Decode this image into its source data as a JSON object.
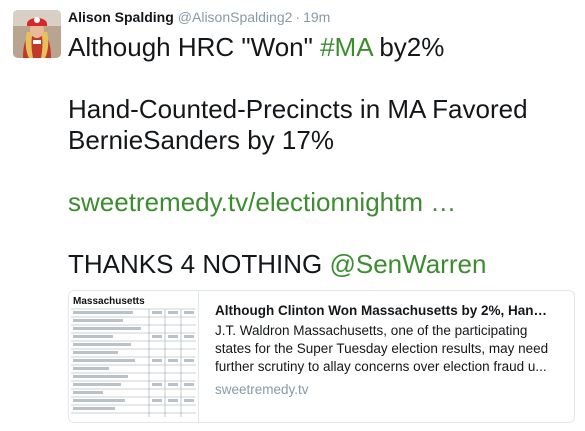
{
  "user": {
    "name": "Alison Spalding",
    "handle": "@AlisonSpalding2",
    "separator": "·",
    "time": "19m"
  },
  "tweet": {
    "line1_pre": "Although HRC \"Won\" ",
    "hashtag": "#MA",
    "line1_post": " by2%",
    "line2": "Hand-Counted-Precincts in MA Favored BernieSanders by 17%",
    "url": "sweetremedy.tv/electionnightm …",
    "line4_pre": "THANKS 4 NOTHING ",
    "mention": "@SenWarren"
  },
  "card": {
    "title": "Although Clinton Won Massachusetts by 2%, Hand ...",
    "description": "J.T. Waldron Massachusetts, one of the participating states for the Super Tuesday election results, may need further scrutiny to allay concerns over election fraud u...",
    "domain": "sweetremedy.tv",
    "thumbnail_heading": "Massachusetts"
  },
  "colors": {
    "link": "#3b8d2f",
    "muted": "#8899a6",
    "text": "#14171a"
  }
}
